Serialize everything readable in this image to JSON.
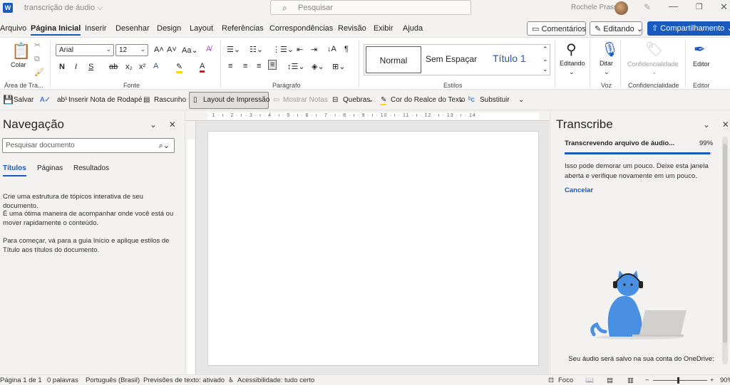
{
  "titlebar": {
    "doc_title": "transcrição de áudio ⌵",
    "search_placeholder": "Pesquisar",
    "user_name": "Rochele Prass"
  },
  "menu": {
    "tabs": [
      "Arquivo",
      "Página Inicial",
      "Inserir",
      "Desenhar",
      "Design",
      "Layout",
      "Referências",
      "Correspondências",
      "Revisão",
      "Exibir",
      "Ajuda"
    ],
    "comments": "Comentários",
    "editing": "Editando",
    "share": "Compartilhamento"
  },
  "ribbon": {
    "paste_label": "Colar",
    "clipboard_group": "Área de Tra...",
    "font_name": "Arial",
    "font_size": "12",
    "font_group": "Fonte",
    "paragraph_group": "Parágrafo",
    "styles": [
      "Normal",
      "Sem Espaçar",
      "Título 1"
    ],
    "styles_group": "Estilos",
    "editing_label": "Editando",
    "dictate_label": "Ditar",
    "voice_group": "Voz",
    "sensitivity_label": "Confidencialidade",
    "sensitivity_group": "Confidencialidade",
    "editor_label": "Editor",
    "editor_group": "Editor"
  },
  "qat": {
    "save": "Salvar",
    "footnote": "Inserir Nota de Rodapé",
    "draft": "Rascunho",
    "print_layout": "Layout de Impressão",
    "show_notes": "Mostrar Notas",
    "breaks": "Quebras",
    "highlight": "Cor do Realce do Texto",
    "replace": "Substituir"
  },
  "navigation": {
    "title": "Navegação",
    "search_placeholder": "Pesquisar documento",
    "tabs": [
      "Títulos",
      "Páginas",
      "Resultados"
    ],
    "p1": "Crie uma estrutura de tópicos interativa de seu documento.",
    "p2": "É uma ótima maneira de acompanhar onde você está ou mover rapidamente o conteúdo.",
    "p3": "Para começar, vá para a guia Início e aplique estilos de Título aos títulos do documento."
  },
  "transcribe": {
    "title": "Transcribe",
    "status": "Transcrevendo arquivo de áudio...",
    "percent": "99%",
    "progress": 0.99,
    "message": "Isso pode demorar um pouco. Deixe esta janela aberta e verifique novamente em um pouco.",
    "cancel": "Cancelar",
    "footer": "Seu áudio será salvo na sua conta do OneDrive:"
  },
  "statusbar": {
    "page": "Página 1 de 1",
    "words": "0 palavras",
    "language": "Português (Brasil)",
    "predictions": "Previsões de texto: ativado",
    "accessibility": "Acessibilidade: tudo certo",
    "focus": "Foco",
    "zoom": "90%"
  },
  "colors": {
    "accent": "#185abd",
    "cat": "#4a90e2"
  }
}
